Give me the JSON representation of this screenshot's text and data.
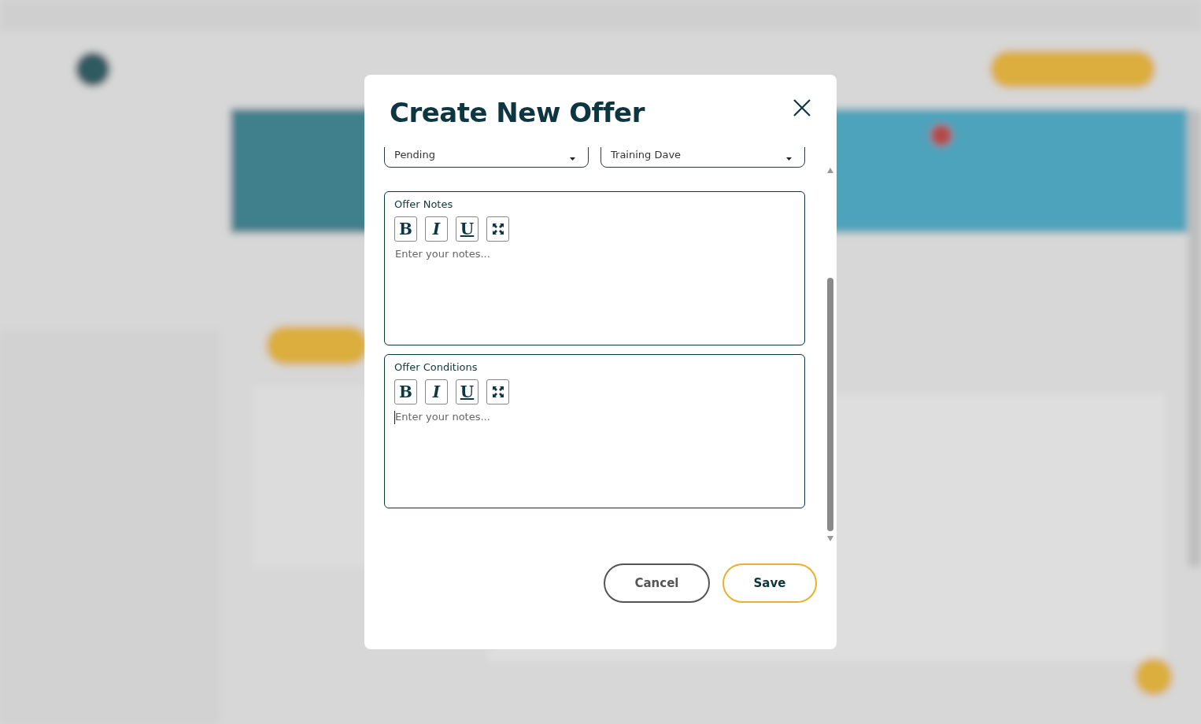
{
  "dialog": {
    "title": "Create New Offer",
    "selects": [
      {
        "value": "Pending"
      },
      {
        "value": "Training Dave"
      }
    ],
    "editors": [
      {
        "label": "Offer Notes",
        "placeholder": "Enter your notes...",
        "focused": false,
        "tools": [
          {
            "kind": "bold",
            "label": "B"
          },
          {
            "kind": "italic",
            "label": "I"
          },
          {
            "kind": "underline",
            "label": "U"
          },
          {
            "kind": "expand"
          }
        ]
      },
      {
        "label": "Offer Conditions",
        "placeholder": "Enter your notes...",
        "focused": true,
        "tools": [
          {
            "kind": "bold",
            "label": "B"
          },
          {
            "kind": "italic",
            "label": "I"
          },
          {
            "kind": "underline",
            "label": "U"
          },
          {
            "kind": "expand"
          }
        ]
      }
    ],
    "buttons": [
      {
        "kind": "secondary",
        "label": "Cancel"
      },
      {
        "kind": "primary",
        "label": "Save"
      }
    ]
  }
}
